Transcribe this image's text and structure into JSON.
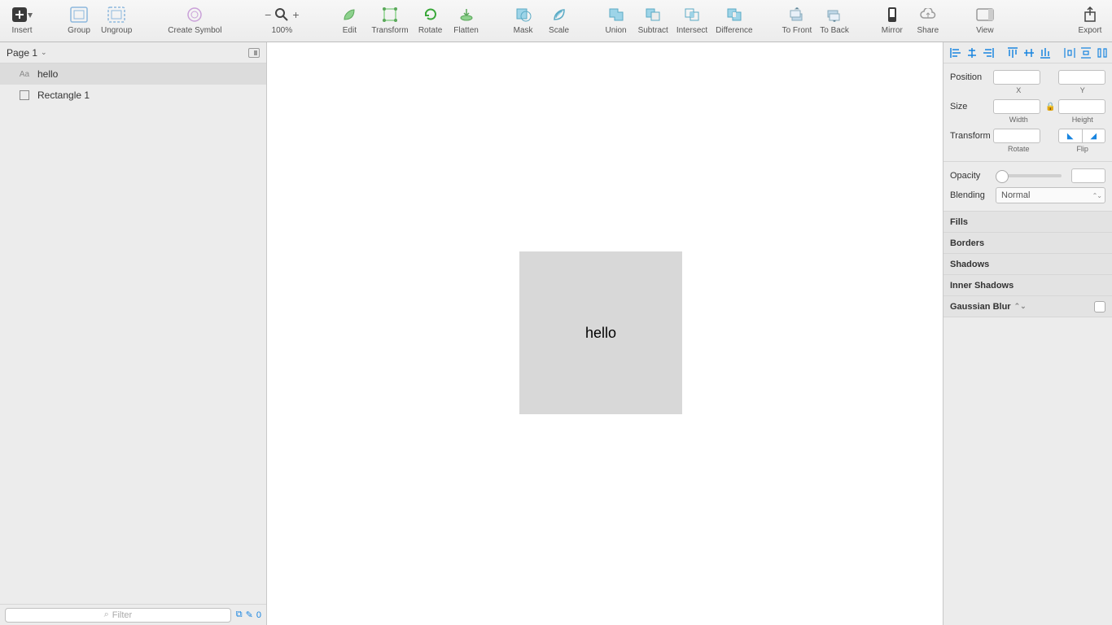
{
  "toolbar": {
    "insert": "Insert",
    "group": "Group",
    "ungroup": "Ungroup",
    "create_symbol": "Create Symbol",
    "zoom": "100%",
    "edit": "Edit",
    "transform": "Transform",
    "rotate": "Rotate",
    "flatten": "Flatten",
    "mask": "Mask",
    "scale": "Scale",
    "union": "Union",
    "subtract": "Subtract",
    "intersect": "Intersect",
    "difference": "Difference",
    "to_front": "To Front",
    "to_back": "To Back",
    "mirror": "Mirror",
    "share": "Share",
    "view": "View",
    "export": "Export"
  },
  "left_panel": {
    "page_name": "Page 1",
    "layers": [
      {
        "name": "hello",
        "type": "text",
        "selected": true
      },
      {
        "name": "Rectangle 1",
        "type": "rect",
        "selected": false
      }
    ],
    "filter_placeholder": "Filter",
    "filter_count": "0"
  },
  "canvas": {
    "rect_text": "hello"
  },
  "inspector": {
    "position_label": "Position",
    "x_label": "X",
    "y_label": "Y",
    "size_label": "Size",
    "width_label": "Width",
    "height_label": "Height",
    "transform_label": "Transform",
    "rotate_label": "Rotate",
    "flip_label": "Flip",
    "opacity_label": "Opacity",
    "blending_label": "Blending",
    "blending_value": "Normal",
    "sections": {
      "fills": "Fills",
      "borders": "Borders",
      "shadows": "Shadows",
      "inner_shadows": "Inner Shadows",
      "gaussian_blur": "Gaussian Blur"
    }
  }
}
